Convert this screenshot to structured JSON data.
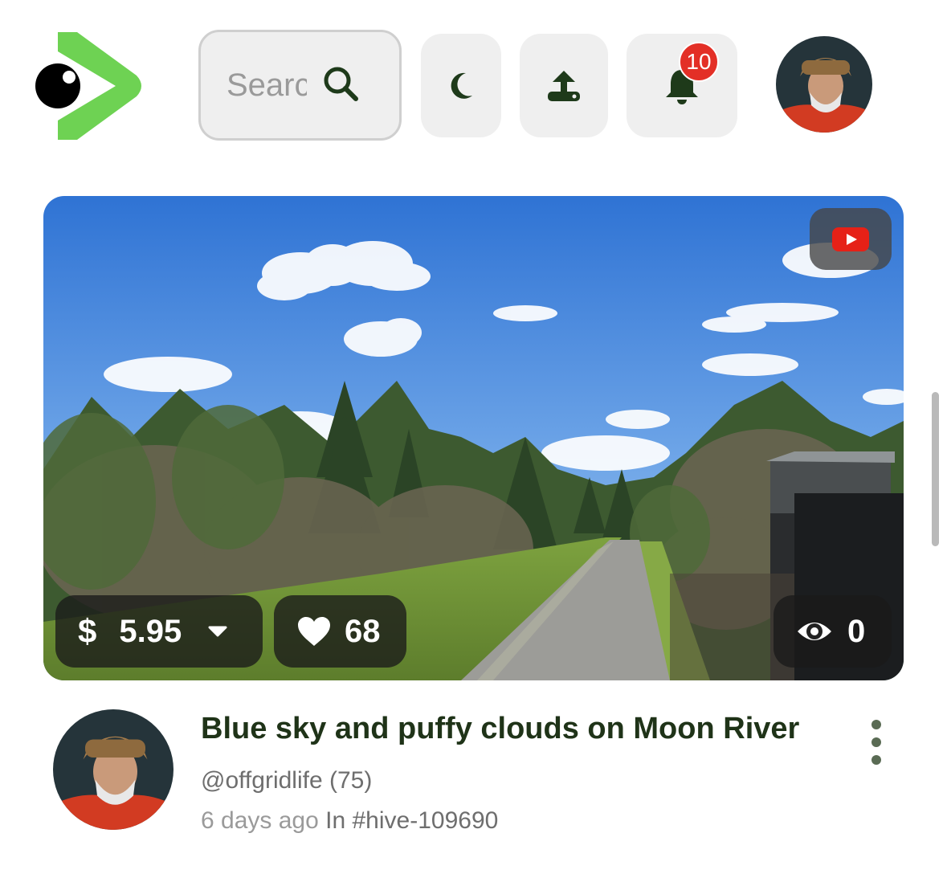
{
  "header": {
    "search_placeholder": "Search",
    "notification_count": "10"
  },
  "video": {
    "payout_currency": "$",
    "payout": "5.95",
    "likes": "68",
    "views": "0",
    "title": "Blue sky and puffy clouds on Moon River",
    "author": "@offgridlife",
    "reputation": "(75)",
    "age": "6 days ago",
    "in_label": "In",
    "community": "#hive-109690"
  },
  "colors": {
    "brand_green": "#6ed253",
    "title_green": "#1f3318",
    "icon_dark_green": "#1e3a1a",
    "badge_red": "#e32f26",
    "youtube_red": "#e62117"
  },
  "icons": {
    "logo": "eye-play-logo-icon",
    "search": "search-icon",
    "theme": "moon-icon",
    "upload": "upload-icon",
    "notifications": "bell-icon",
    "source": "youtube-icon",
    "likes": "heart-icon",
    "views": "eye-icon",
    "payout_toggle": "caret-down-icon",
    "menu": "more-vertical-icon"
  }
}
